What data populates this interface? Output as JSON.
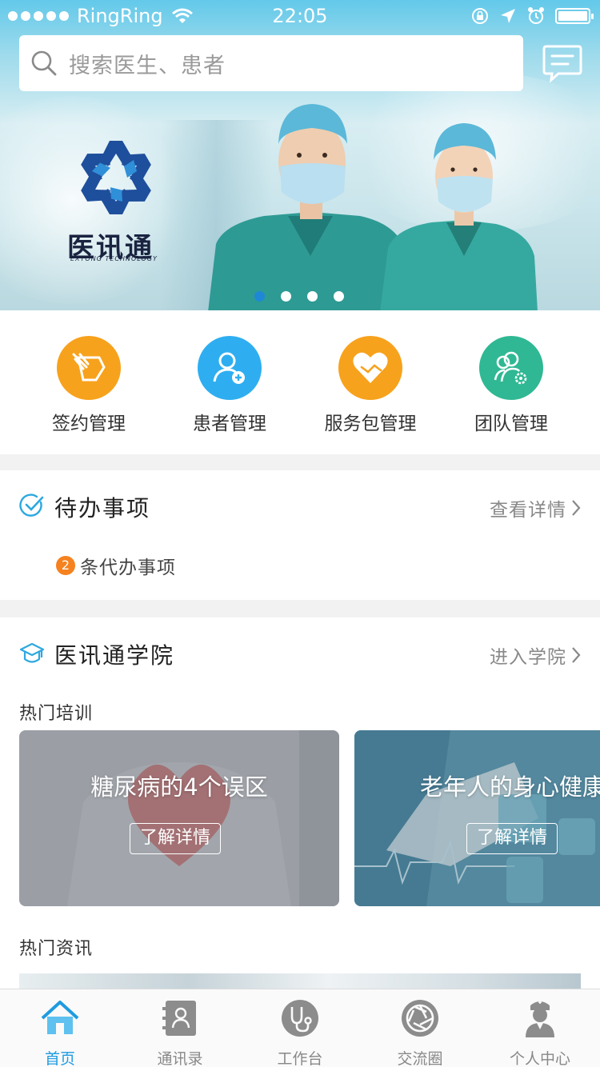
{
  "status_bar": {
    "carrier": "RingRing",
    "time": "22:05"
  },
  "search": {
    "placeholder": "搜索医生、患者"
  },
  "banner": {
    "logo_name": "医讯通",
    "logo_subtitle": "EXTONG TECHNOLOGY",
    "slide_count": 4,
    "active_slide": 1
  },
  "quick_menu": [
    {
      "label": "签约管理",
      "icon": "handshake-sign-icon",
      "color": "#f7a21c"
    },
    {
      "label": "患者管理",
      "icon": "patient-add-icon",
      "color": "#2eaef0"
    },
    {
      "label": "服务包管理",
      "icon": "heart-hands-icon",
      "color": "#f7a21c"
    },
    {
      "label": "团队管理",
      "icon": "team-gear-icon",
      "color": "#2fb893"
    }
  ],
  "todo": {
    "title": "待办事项",
    "more": "查看详情",
    "count": "2",
    "text": "条代办事项"
  },
  "academy": {
    "title": "医讯通学院",
    "more": "进入学院",
    "training_heading": "热门培训",
    "courses": [
      {
        "title": "糖尿病的4个误区",
        "button": "了解详情"
      },
      {
        "title": "老年人的身心健康",
        "button": "了解详情"
      }
    ],
    "news_heading": "热门资讯"
  },
  "tabs": [
    {
      "label": "首页",
      "icon": "home-icon",
      "active": true
    },
    {
      "label": "通讯录",
      "icon": "contacts-icon",
      "active": false
    },
    {
      "label": "工作台",
      "icon": "stethoscope-icon",
      "active": false
    },
    {
      "label": "交流圈",
      "icon": "aperture-icon",
      "active": false
    },
    {
      "label": "个人中心",
      "icon": "nurse-icon",
      "active": false
    }
  ],
  "colors": {
    "accent": "#1f9be0",
    "badge": "#f5821f"
  }
}
